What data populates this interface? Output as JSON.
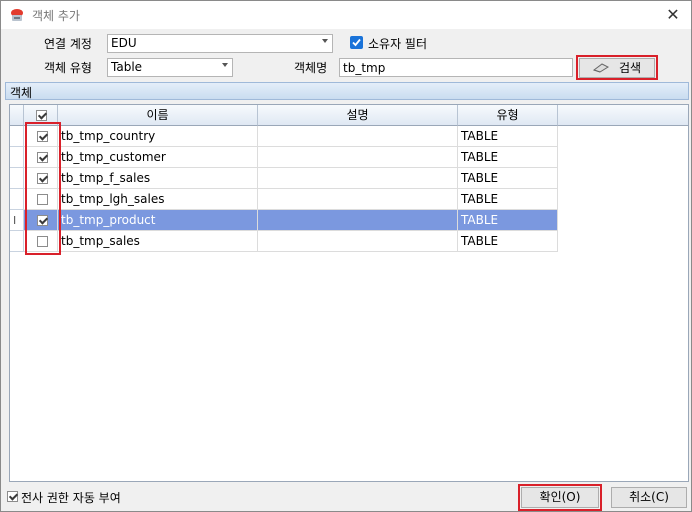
{
  "window": {
    "title": "객체 추가"
  },
  "form": {
    "connection_label": "연결 계정",
    "connection_value": "EDU",
    "owner_filter_label": "소유자 필터",
    "owner_filter_checked": true,
    "object_type_label": "객체 유형",
    "object_type_value": "Table",
    "object_name_label": "객체명",
    "object_name_value": "tb_tmp",
    "search_button": "검색"
  },
  "group": {
    "title": "객체"
  },
  "grid": {
    "columns": [
      "이름",
      "설명",
      "유형"
    ],
    "header_checked": true,
    "rows": [
      {
        "checked": true,
        "name": "tb_tmp_country",
        "desc": "",
        "type": "TABLE",
        "selected": false
      },
      {
        "checked": true,
        "name": "tb_tmp_customer",
        "desc": "",
        "type": "TABLE",
        "selected": false
      },
      {
        "checked": true,
        "name": "tb_tmp_f_sales",
        "desc": "",
        "type": "TABLE",
        "selected": false
      },
      {
        "checked": false,
        "name": "tb_tmp_lgh_sales",
        "desc": "",
        "type": "TABLE",
        "selected": false
      },
      {
        "checked": true,
        "name": "tb_tmp_product",
        "desc": "",
        "type": "TABLE",
        "selected": true
      },
      {
        "checked": false,
        "name": "tb_tmp_sales",
        "desc": "",
        "type": "TABLE",
        "selected": false
      }
    ]
  },
  "footer": {
    "auto_grant_label": "전사 권한 자동 부여",
    "auto_grant_checked": true,
    "ok_button": "확인(O)",
    "cancel_button": "취소(C)"
  },
  "colors": {
    "selection": "#7b98df",
    "highlight_box": "#d9202a",
    "accent": "#1a73d9"
  }
}
